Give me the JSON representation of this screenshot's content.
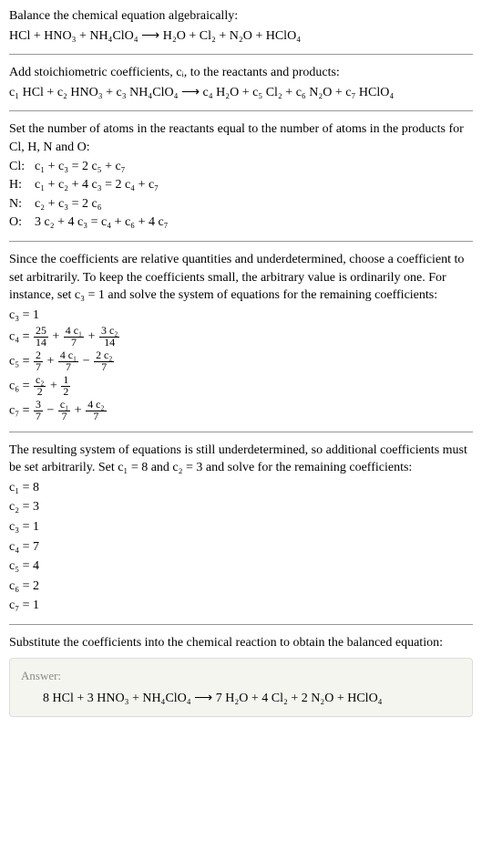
{
  "intro": {
    "line1": "Balance the chemical equation algebraically:",
    "eq": "HCl + HNO₃ + NH₄ClO₄  ⟶  H₂O + Cl₂ + N₂O + HClO₄"
  },
  "stoich": {
    "line1": "Add stoichiometric coefficients, cᵢ, to the reactants and products:",
    "eq": "c₁ HCl + c₂ HNO₃ + c₃ NH₄ClO₄  ⟶  c₄ H₂O + c₅ Cl₂ + c₆ N₂O + c₇ HClO₄"
  },
  "atoms": {
    "intro": "Set the number of atoms in the reactants equal to the number of atoms in the products for Cl, H, N and O:",
    "cl_label": "Cl:",
    "cl_eq": "c₁ + c₃ = 2 c₅ + c₇",
    "h_label": "H:",
    "h_eq": "c₁ + c₂ + 4 c₃ = 2 c₄ + c₇",
    "n_label": "N:",
    "n_eq": "c₂ + c₃ = 2 c₆",
    "o_label": "O:",
    "o_eq": "3 c₂ + 4 c₃ = c₄ + c₆ + 4 c₇"
  },
  "underdet1": {
    "text": "Since the coefficients are relative quantities and underdetermined, choose a coefficient to set arbitrarily. To keep the coefficients small, the arbitrary value is ordinarily one. For instance, set c₃ = 1 and solve the system of equations for the remaining coefficients:",
    "c3": "c₃ = 1",
    "c4_lhs": "c₄ = ",
    "c4_f1_num": "25",
    "c4_f1_den": "14",
    "c4_f2_num": "4 c₁",
    "c4_f2_den": "7",
    "c4_f3_num": "3 c₂",
    "c4_f3_den": "14",
    "c5_lhs": "c₅ = ",
    "c5_f1_num": "2",
    "c5_f1_den": "7",
    "c5_f2_num": "4 c₁",
    "c5_f2_den": "7",
    "c5_f3_num": "2 c₂",
    "c5_f3_den": "7",
    "c6_lhs": "c₆ = ",
    "c6_f1_num": "c₂",
    "c6_f1_den": "2",
    "c6_f2_num": "1",
    "c6_f2_den": "2",
    "c7_lhs": "c₇ = ",
    "c7_f1_num": "3",
    "c7_f1_den": "7",
    "c7_f2_num": "c₁",
    "c7_f2_den": "7",
    "c7_f3_num": "4 c₂",
    "c7_f3_den": "7",
    "plus": " + ",
    "minus": " − "
  },
  "underdet2": {
    "text": "The resulting system of equations is still underdetermined, so additional coefficients must be set arbitrarily. Set c₁ = 8 and c₂ = 3 and solve for the remaining coefficients:",
    "c1": "c₁ = 8",
    "c2": "c₂ = 3",
    "c3": "c₃ = 1",
    "c4": "c₄ = 7",
    "c5": "c₅ = 4",
    "c6": "c₆ = 2",
    "c7": "c₇ = 1"
  },
  "final": {
    "text": "Substitute the coefficients into the chemical reaction to obtain the balanced equation:",
    "answer_label": "Answer:",
    "answer_eq": "8 HCl + 3 HNO₃ + NH₄ClO₄  ⟶  7 H₂O + 4 Cl₂ + 2 N₂O + HClO₄"
  }
}
